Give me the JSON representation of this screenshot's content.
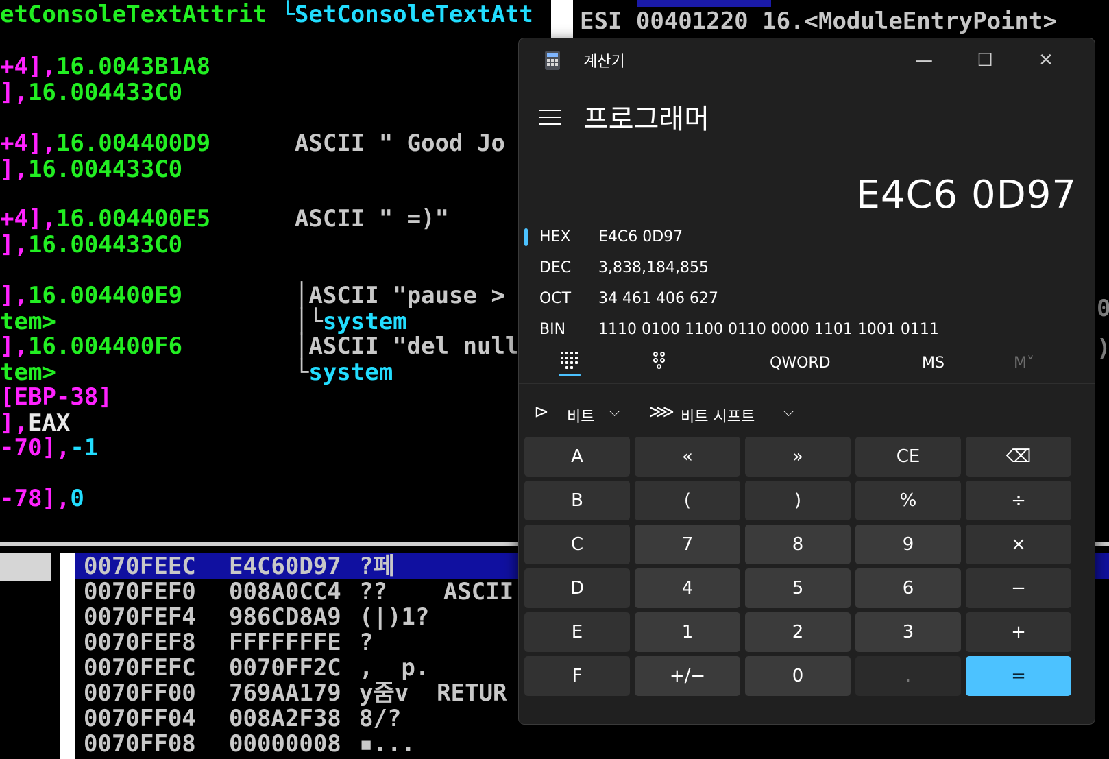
{
  "debugger": {
    "code_lines": [
      [
        {
          "t": "etConsoleTextAttrit ",
          "c": "green"
        },
        {
          "t": "└SetConsoleTextAtt",
          "c": "cyan"
        }
      ],
      [
        {
          "t": "+4],",
          "c": "magenta"
        },
        {
          "t": "16.0043B1A8",
          "c": "green"
        }
      ],
      [
        {
          "t": "],",
          "c": "magenta"
        },
        {
          "t": "16.004433C0",
          "c": "green"
        }
      ],
      [
        {
          "t": "+4],",
          "c": "magenta"
        },
        {
          "t": "16.004400D9",
          "c": "green"
        },
        {
          "t": "      ASCII \" Good Jo",
          "c": "grey"
        }
      ],
      [
        {
          "t": "],",
          "c": "magenta"
        },
        {
          "t": "16.004433C0",
          "c": "green"
        }
      ],
      [
        {
          "t": "+4],",
          "c": "magenta"
        },
        {
          "t": "16.004400E5",
          "c": "green"
        },
        {
          "t": "      ASCII \" =)\"",
          "c": "grey"
        }
      ],
      [
        {
          "t": "],",
          "c": "magenta"
        },
        {
          "t": "16.004433C0",
          "c": "green"
        }
      ],
      [
        {
          "t": "],",
          "c": "magenta"
        },
        {
          "t": "16.004400E9",
          "c": "green"
        },
        {
          "t": "        │ASCII \"pause >",
          "c": "grey"
        }
      ],
      [
        {
          "t": "tem>",
          "c": "green"
        },
        {
          "t": "                 │└",
          "c": "grey"
        },
        {
          "t": "system",
          "c": "cyan"
        }
      ],
      [
        {
          "t": "],",
          "c": "magenta"
        },
        {
          "t": "16.004400F6",
          "c": "green"
        },
        {
          "t": "        │ASCII \"del null",
          "c": "grey"
        }
      ],
      [
        {
          "t": "tem>",
          "c": "green"
        },
        {
          "t": "                 └",
          "c": "grey"
        },
        {
          "t": "system",
          "c": "cyan"
        }
      ],
      [
        {
          "t": "[EBP-38]",
          "c": "magenta"
        }
      ],
      [
        {
          "t": "],",
          "c": "magenta"
        },
        {
          "t": "EAX",
          "c": "white"
        }
      ],
      [
        {
          "t": "-70],",
          "c": "magenta"
        },
        {
          "t": "-1",
          "c": "cyan"
        }
      ],
      [
        {
          "t": "",
          "c": "grey"
        }
      ],
      [
        {
          "t": "-78],",
          "c": "magenta"
        },
        {
          "t": "0",
          "c": "cyan"
        }
      ]
    ],
    "code_tops": [
      2,
      78,
      116,
      190,
      228,
      300,
      338,
      412,
      450,
      486,
      524,
      560,
      598,
      634,
      672,
      708
    ],
    "reg_line": "ESI 00401220 16.<ModuleEntryPoint>",
    "right_fragments": [
      "0",
      ")"
    ],
    "stack_rows": [
      {
        "addr": "0070FEEC",
        "val": "E4C60D97",
        "rest": "?페"
      },
      {
        "addr": "0070FEF0",
        "val": "008A0CC4",
        "rest": "??    ASCII"
      },
      {
        "addr": "0070FEF4",
        "val": "986CD8A9",
        "rest": "(|)1?"
      },
      {
        "addr": "0070FEF8",
        "val": "FFFFFFFE",
        "rest": "?"
      },
      {
        "addr": "0070FEFC",
        "val": "0070FF2C",
        "rest": ",  p."
      },
      {
        "addr": "0070FF00",
        "val": "769AA179",
        "rest": "y줌v  RETUR"
      },
      {
        "addr": "0070FF04",
        "val": "008A2F38",
        "rest": "8/?"
      },
      {
        "addr": "0070FF08",
        "val": "00000008",
        "rest": "▪..."
      }
    ]
  },
  "calculator": {
    "title": "계산기",
    "window_controls": {
      "minimize": "—",
      "maximize": "☐",
      "close": "✕"
    },
    "mode": "프로그래머",
    "display": "E4C6 0D97",
    "radix": [
      {
        "label": "HEX",
        "value": "E4C6 0D97",
        "selected": true
      },
      {
        "label": "DEC",
        "value": "3,838,184,855",
        "selected": false
      },
      {
        "label": "OCT",
        "value": "34 461 406 627",
        "selected": false
      },
      {
        "label": "BIN",
        "value": "1110 0100 1100 0110 0000 1101 1001 0111",
        "selected": false
      }
    ],
    "tabs": {
      "word_size": "QWORD",
      "ms": "MS",
      "m": "M˅"
    },
    "dropdowns": [
      {
        "icon": "bitwise-gate-icon",
        "label": "비트"
      },
      {
        "icon": "bit-shift-icon",
        "label": "비트 시프트"
      }
    ],
    "keys": [
      [
        "A",
        "«",
        "»",
        "CE",
        "⌫"
      ],
      [
        "B",
        "(",
        ")",
        "%",
        "÷"
      ],
      [
        "C",
        "7",
        "8",
        "9",
        "×"
      ],
      [
        "D",
        "4",
        "5",
        "6",
        "−"
      ],
      [
        "E",
        "1",
        "2",
        "3",
        "+"
      ],
      [
        "F",
        "+/−",
        "0",
        ".",
        "="
      ]
    ],
    "accent_color": "#4cc2ff"
  }
}
